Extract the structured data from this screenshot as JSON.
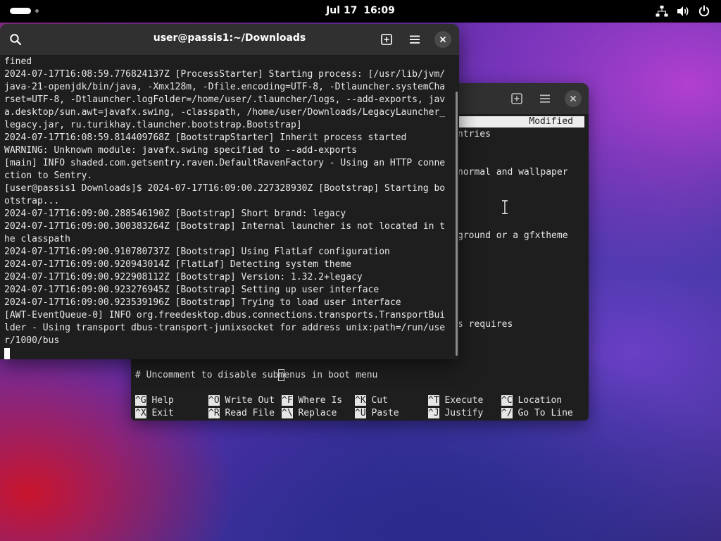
{
  "topbar": {
    "clock_date": "Jul 17",
    "clock_time": "16:09"
  },
  "terminal": {
    "title": "user@passis1:~/Downloads",
    "lines": [
      "fined",
      "2024-07-17T16:08:59.776824137Z [ProcessStarter] Starting process: [/usr/lib/jvm/",
      "java-21-openjdk/bin/java, -Xmx128m, -Dfile.encoding=UTF-8, -Dtlauncher.systemCha",
      "rset=UTF-8, -Dtlauncher.logFolder=/home/user/.tlauncher/logs, --add-exports, jav",
      "a.desktop/sun.awt=javafx.swing, -classpath, /home/user/Downloads/LegacyLauncher_",
      "legacy.jar, ru.turikhay.tlauncher.bootstrap.Bootstrap]",
      "2024-07-17T16:08:59.814409768Z [BootstrapStarter] Inherit process started",
      "WARNING: Unknown module: javafx.swing specified to --add-exports",
      "[main] INFO shaded.com.getsentry.raven.DefaultRavenFactory - Using an HTTP conne",
      "ction to Sentry.",
      "[user@passis1 Downloads]$ 2024-07-17T16:09:00.227328930Z [Bootstrap] Starting bo",
      "otstrap...",
      "2024-07-17T16:09:00.288546190Z [Bootstrap] Short brand: legacy",
      "2024-07-17T16:09:00.300383264Z [Bootstrap] Internal launcher is not located in t",
      "he classpath",
      "2024-07-17T16:09:00.910780737Z [Bootstrap] Using FlatLaf configuration",
      "2024-07-17T16:09:00.920943014Z [FlatLaf] Detecting system theme",
      "2024-07-17T16:09:00.922908112Z [Bootstrap] Version: 1.32.2+legacy",
      "2024-07-17T16:09:00.923276945Z [Bootstrap] Setting up user interface",
      "2024-07-17T16:09:00.923539196Z [Bootstrap] Trying to load user interface",
      "[AWT-EventQueue-0] INFO org.freedesktop.dbus.connections.transports.TransportBui",
      "lder - Using transport dbus-transport-junixsocket for address unix:path=/run/use",
      "r/1000/bus"
    ]
  },
  "nano": {
    "modified_label": "Modified",
    "visible_fragments": {
      "f1": "ntries",
      "f2": "normal and wallpaper",
      "f3": "ground or a gfxtheme",
      "f4": "s requires"
    },
    "comment_pre": "# Uncomment to disable sub",
    "comment_cursor_char": "m",
    "comment_post": "enus in boot menu",
    "shortcuts": [
      {
        "key": "^G",
        "label": "Help"
      },
      {
        "key": "^X",
        "label": "Exit"
      },
      {
        "key": "^O",
        "label": "Write Out"
      },
      {
        "key": "^R",
        "label": "Read File"
      },
      {
        "key": "^F",
        "label": "Where Is"
      },
      {
        "key": "^\\",
        "label": "Replace"
      },
      {
        "key": "^K",
        "label": "Cut"
      },
      {
        "key": "^U",
        "label": "Paste"
      },
      {
        "key": "^T",
        "label": "Execute"
      },
      {
        "key": "^J",
        "label": "Justify"
      },
      {
        "key": "^C",
        "label": "Location"
      },
      {
        "key": "^/",
        "label": "Go To Line"
      }
    ]
  },
  "icons": {
    "network": "network-wired-icon",
    "volume": "speaker-icon",
    "power": "power-icon",
    "search": "search-icon",
    "new_tab": "new-tab-icon",
    "menu": "hamburger-menu-icon",
    "close": "close-icon"
  }
}
